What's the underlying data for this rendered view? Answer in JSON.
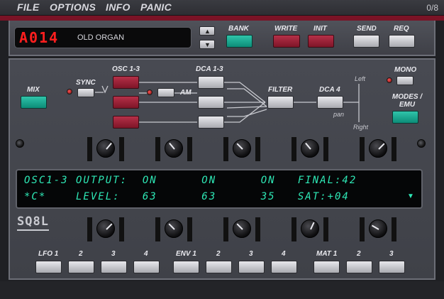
{
  "menu": {
    "file": "FILE",
    "options": "OPTIONS",
    "info": "INFO",
    "panic": "PANIC",
    "voices": "0/8"
  },
  "program": {
    "number": "A014",
    "name": "OLD ORGAN"
  },
  "buttons": {
    "bank": "BANK",
    "write": "WRITE",
    "init": "INIT",
    "send": "SEND",
    "req": "REQ",
    "mix": "MIX",
    "sync": "SYNC",
    "osc": "OSC 1-3",
    "dca13": "DCA 1-3",
    "am": "AM",
    "filter": "FILTER",
    "dca4": "DCA 4",
    "mono": "MONO",
    "modes": "MODES / EMU",
    "left": "Left",
    "right": "Right",
    "pan": "pan"
  },
  "display": {
    "line1": "OSC1-3 OUTPUT:  ON      ON      ON   FINAL:42",
    "line2": "*C*    LEVEL:   63      63      35   SAT:+04"
  },
  "logo": "SQ8L",
  "mods": {
    "lfo1": "LFO 1",
    "lfo2": "2",
    "lfo3": "3",
    "lfo4": "4",
    "env1": "ENV 1",
    "env2": "2",
    "env3": "3",
    "env4": "4",
    "mat1": "MAT 1",
    "mat2": "2",
    "mat3": "3"
  },
  "colors": {
    "accent_teal": "#14a68d",
    "accent_red": "#9a1e35",
    "lcd_green": "#2ee8b6",
    "lcd_red": "#ff1e1e"
  }
}
